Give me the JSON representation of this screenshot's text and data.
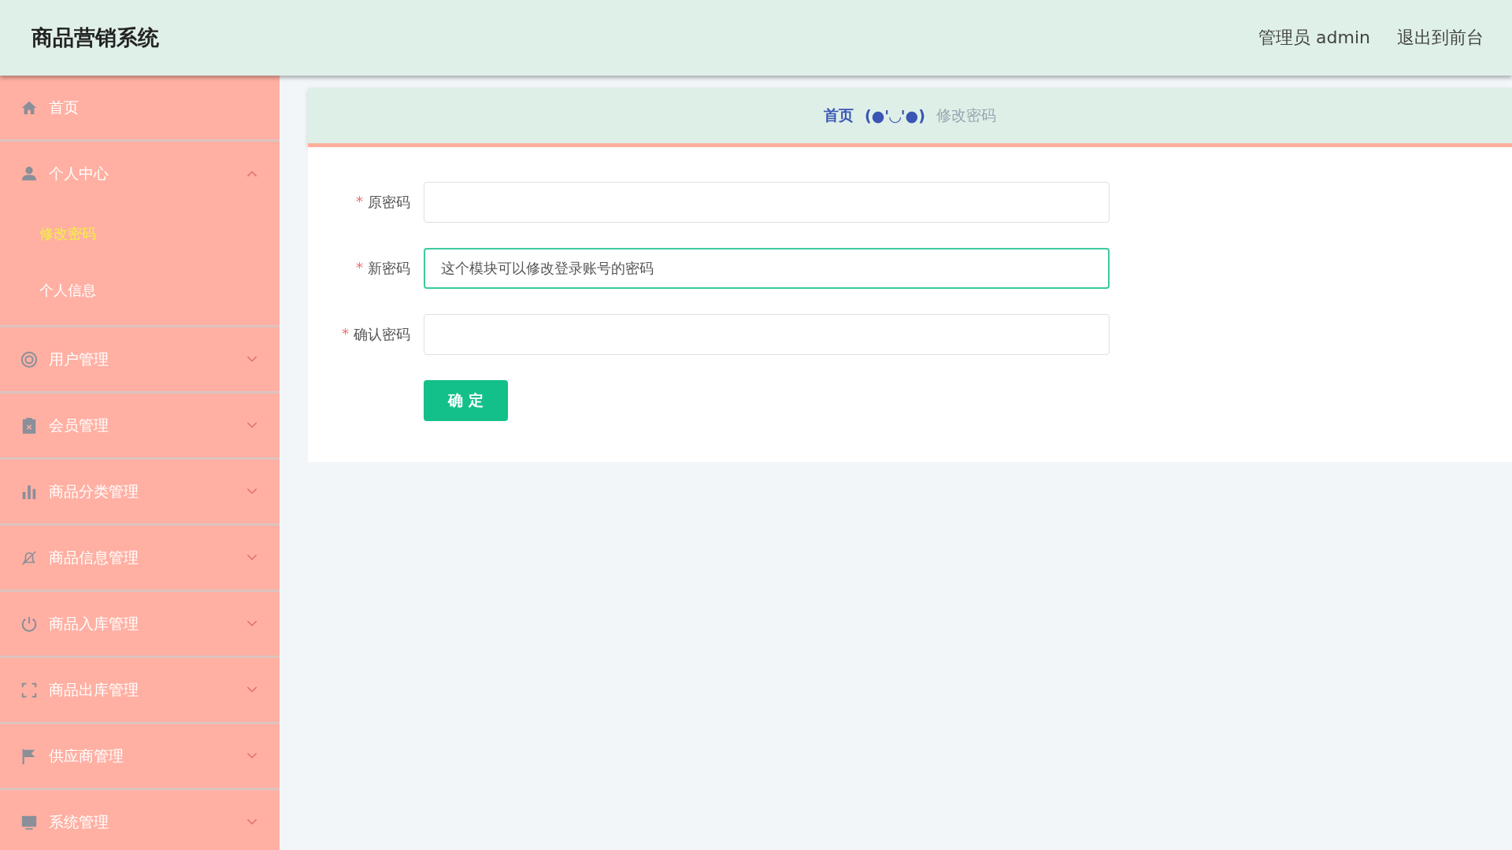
{
  "header": {
    "title": "商品营销系统",
    "user": "管理员 admin",
    "exit_link": "退出到前台"
  },
  "sidebar": {
    "items": [
      {
        "kind": "link",
        "label": "首页"
      },
      {
        "kind": "group",
        "label": "个人中心",
        "expanded": true,
        "children": [
          {
            "label": "修改密码",
            "selected": true
          },
          {
            "label": "个人信息",
            "selected": false
          }
        ]
      },
      {
        "kind": "group",
        "label": "用户管理",
        "expanded": false
      },
      {
        "kind": "group",
        "label": "会员管理",
        "expanded": false
      },
      {
        "kind": "group",
        "label": "商品分类管理",
        "expanded": false
      },
      {
        "kind": "group",
        "label": "商品信息管理",
        "expanded": false
      },
      {
        "kind": "group",
        "label": "商品入库管理",
        "expanded": false
      },
      {
        "kind": "group",
        "label": "商品出库管理",
        "expanded": false
      },
      {
        "kind": "group",
        "label": "供应商管理",
        "expanded": false
      },
      {
        "kind": "group",
        "label": "系统管理",
        "expanded": false
      }
    ]
  },
  "breadcrumb": {
    "home": "首页",
    "separator": "(●'◡'●)",
    "current": "修改密码"
  },
  "form": {
    "fields": [
      {
        "required_mark": "*",
        "label": "原密码",
        "focused": false
      },
      {
        "required_mark": "*",
        "label": "新密码",
        "value": "这个模块可以修改登录账号的密码",
        "focused": true
      },
      {
        "required_mark": "*",
        "label": "确认密码",
        "focused": false
      }
    ],
    "submit": "确 定"
  }
}
